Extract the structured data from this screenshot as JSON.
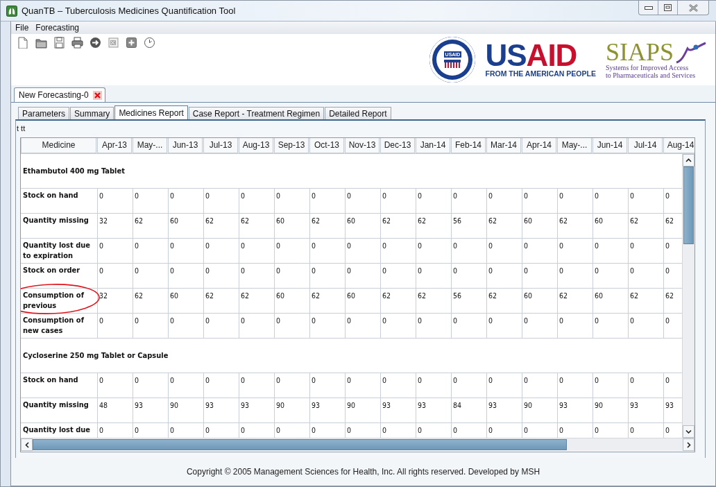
{
  "window": {
    "title": "QuanTB – Tuberculosis Medicines Quantification Tool"
  },
  "menu": [
    "File",
    "Forecasting"
  ],
  "logos": {
    "usaid": {
      "seal_label": "USAID",
      "name": "USAID",
      "tagline": "FROM THE AMERICAN PEOPLE"
    },
    "siaps": {
      "name": "SIAPS",
      "line_1": "Systems for Improved Access",
      "line_2": "to Pharmaceuticals and Services"
    }
  },
  "document_tabs": [
    {
      "label": "New Forecasting-0",
      "selected": true
    }
  ],
  "tabs": [
    {
      "label": "Parameters",
      "selected": false
    },
    {
      "label": "Summary",
      "selected": false
    },
    {
      "label": "Medicines Report",
      "selected": true
    },
    {
      "label": "Case Report - Treatment Regimen",
      "selected": false
    },
    {
      "label": "Detailed Report",
      "selected": false
    }
  ],
  "report_caption": "t tt",
  "table": {
    "columns": [
      "Medicine",
      "Apr-13",
      "May-...",
      "Jun-13",
      "Jul-13",
      "Aug-13",
      "Sep-13",
      "Oct-13",
      "Nov-13",
      "Dec-13",
      "Jan-14",
      "Feb-14",
      "Mar-14",
      "Apr-14",
      "May-...",
      "Jun-14",
      "Jul-14",
      "Aug-14"
    ],
    "groups": [
      {
        "medicine": "Ethambutol  400 mg  Tablet",
        "rows": [
          {
            "label": "Stock on hand",
            "circled": false,
            "values": [
              "0",
              "0",
              "0",
              "0",
              "0",
              "0",
              "0",
              "0",
              "0",
              "0",
              "0",
              "0",
              "0",
              "0",
              "0",
              "0",
              "0"
            ]
          },
          {
            "label": "Quantity missing",
            "circled": false,
            "values": [
              "32",
              "62",
              "60",
              "62",
              "62",
              "60",
              "62",
              "60",
              "62",
              "62",
              "56",
              "62",
              "60",
              "62",
              "60",
              "62",
              "62"
            ]
          },
          {
            "label": "Quantity lost due to expiration",
            "circled": false,
            "values": [
              "0",
              "0",
              "0",
              "0",
              "0",
              "0",
              "0",
              "0",
              "0",
              "0",
              "0",
              "0",
              "0",
              "0",
              "0",
              "0",
              "0"
            ]
          },
          {
            "label": "Stock on order",
            "circled": false,
            "values": [
              "0",
              "0",
              "0",
              "0",
              "0",
              "0",
              "0",
              "0",
              "0",
              "0",
              "0",
              "0",
              "0",
              "0",
              "0",
              "0",
              "0"
            ]
          },
          {
            "label": "Consumption of previous",
            "circled": true,
            "values": [
              "32",
              "62",
              "60",
              "62",
              "62",
              "60",
              "62",
              "60",
              "62",
              "62",
              "56",
              "62",
              "60",
              "62",
              "60",
              "62",
              "62"
            ]
          },
          {
            "label": "Consumption of new cases",
            "circled": false,
            "values": [
              "0",
              "0",
              "0",
              "0",
              "0",
              "0",
              "0",
              "0",
              "0",
              "0",
              "0",
              "0",
              "0",
              "0",
              "0",
              "0",
              "0"
            ]
          }
        ]
      },
      {
        "medicine": "Cycloserine  250 mg  Tablet or Capsule",
        "rows": [
          {
            "label": "Stock on hand",
            "circled": false,
            "values": [
              "0",
              "0",
              "0",
              "0",
              "0",
              "0",
              "0",
              "0",
              "0",
              "0",
              "0",
              "0",
              "0",
              "0",
              "0",
              "0",
              "0"
            ]
          },
          {
            "label": "Quantity missing",
            "circled": false,
            "values": [
              "48",
              "93",
              "90",
              "93",
              "93",
              "90",
              "93",
              "90",
              "93",
              "93",
              "84",
              "93",
              "90",
              "93",
              "90",
              "93",
              "93"
            ]
          },
          {
            "label": "Quantity lost due",
            "circled": false,
            "values": [
              "0",
              "0",
              "0",
              "0",
              "0",
              "0",
              "0",
              "0",
              "0",
              "0",
              "0",
              "0",
              "0",
              "0",
              "0",
              "0",
              "0"
            ]
          }
        ]
      }
    ]
  },
  "footer": "Copyright © 2005 Management Sciences for Health, Inc. All rights reserved. Developed by MSH"
}
